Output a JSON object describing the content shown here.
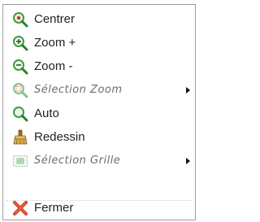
{
  "menu": {
    "items": [
      {
        "label": "Centrer",
        "icon": "magnifier-center-icon",
        "enabled": true,
        "has_submenu": false
      },
      {
        "label": "Zoom +",
        "icon": "zoom-in-icon",
        "enabled": true,
        "has_submenu": false
      },
      {
        "label": "Zoom -",
        "icon": "zoom-out-icon",
        "enabled": true,
        "has_submenu": false
      },
      {
        "label": "Sélection Zoom",
        "icon": "zoom-selection-icon",
        "enabled": false,
        "has_submenu": true
      },
      {
        "label": "Auto",
        "icon": "zoom-auto-icon",
        "enabled": true,
        "has_submenu": false
      },
      {
        "label": "Redessin",
        "icon": "redraw-brush-icon",
        "enabled": true,
        "has_submenu": false
      },
      {
        "label": "Sélection Grille",
        "icon": "grid-selection-icon",
        "enabled": false,
        "has_submenu": true
      },
      {
        "label": "Fermer",
        "icon": "close-icon",
        "enabled": true,
        "has_submenu": false
      }
    ]
  },
  "colors": {
    "menu_border": "#9f9f9f",
    "text": "#222222",
    "disabled_text": "#6d6d6d",
    "icon_green": "#3f9a3f",
    "icon_red": "#cc3b1a"
  }
}
